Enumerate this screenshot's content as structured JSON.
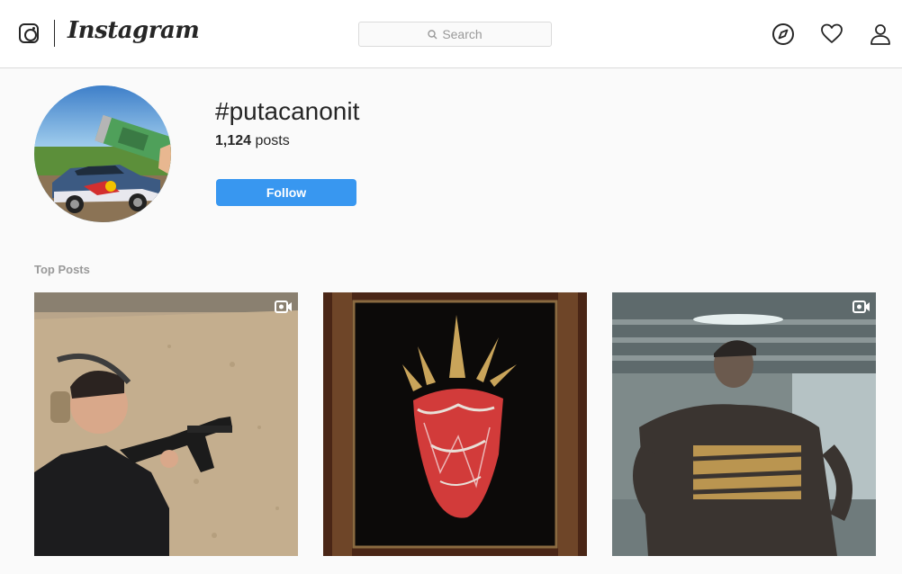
{
  "header": {
    "logo_text": "Instagram",
    "search": {
      "placeholder": "Search"
    },
    "nav": [
      {
        "name": "explore",
        "icon": "compass-icon"
      },
      {
        "name": "activity",
        "icon": "heart-icon"
      },
      {
        "name": "profile",
        "icon": "user-icon"
      }
    ]
  },
  "profile": {
    "hashtag": "#putacanonit",
    "posts_count": "1,124",
    "posts_label": "posts",
    "follow_label": "Follow"
  },
  "top_posts": {
    "title": "Top Posts",
    "items": [
      {
        "kind": "video",
        "icon": "video-camera-icon"
      },
      {
        "kind": "image"
      },
      {
        "kind": "video",
        "icon": "video-camera-icon"
      }
    ]
  },
  "colors": {
    "accent": "#3897f0",
    "border": "#dbdbdb",
    "background": "#fafafa",
    "text": "#262626",
    "muted": "#999999"
  }
}
